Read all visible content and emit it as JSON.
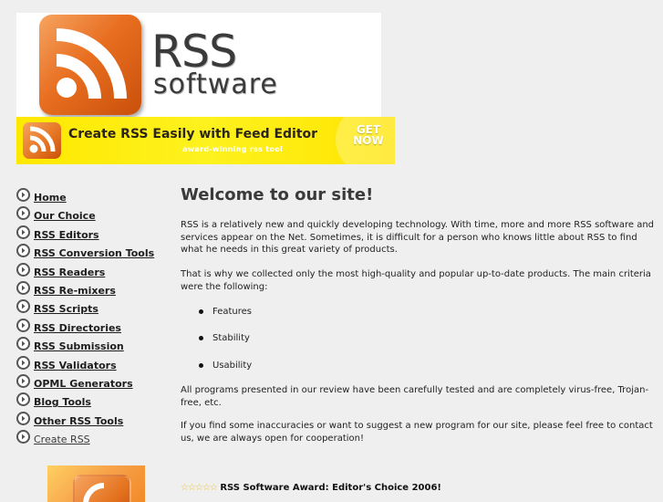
{
  "logo": {
    "line1": "RSS",
    "line2": "software"
  },
  "banner": {
    "title": "Create RSS Easily with Feed Editor",
    "subtitle": "award-winning rss tool",
    "cta_line1": "GET",
    "cta_line2": "NOW"
  },
  "nav": {
    "items": [
      {
        "label": "Home"
      },
      {
        "label": "Our Choice"
      },
      {
        "label": "RSS Editors"
      },
      {
        "label": "RSS Conversion Tools"
      },
      {
        "label": "RSS Readers"
      },
      {
        "label": "RSS Re-mixers"
      },
      {
        "label": "RSS Scripts"
      },
      {
        "label": "RSS Directories"
      },
      {
        "label": "RSS Submission"
      },
      {
        "label": "RSS Validators"
      },
      {
        "label": "OPML Generators"
      },
      {
        "label": "Blog Tools"
      },
      {
        "label": "Other RSS Tools"
      },
      {
        "label": "Create RSS"
      }
    ]
  },
  "main": {
    "heading": "Welcome to our site!",
    "para1": "RSS is a relatively new and quickly developing technology. With time, more and more RSS software and services appear on the Net. Sometimes, it is difficult for a person who knows little about RSS to find what he needs in this great variety of products.",
    "para2": "That is why we collected only the most high-quality and popular up-to-date products. The main criteria were the following:",
    "criteria": [
      "Features",
      "Stability",
      "Usability"
    ],
    "para3": "All programs presented in our review have been carefully tested and are completely virus-free, Trojan-free, etc.",
    "para4": "If you find some inaccuracies or want to suggest a new program for our site, please feel free to contact us, we are always open for cooperation!",
    "award": "RSS Software Award: Editor's Choice 2006!",
    "award_stars": "☆☆☆☆☆"
  },
  "colors": {
    "rss_orange": "#e86e20",
    "banner_yellow": "#ffe800",
    "page_background": "#efefef"
  }
}
